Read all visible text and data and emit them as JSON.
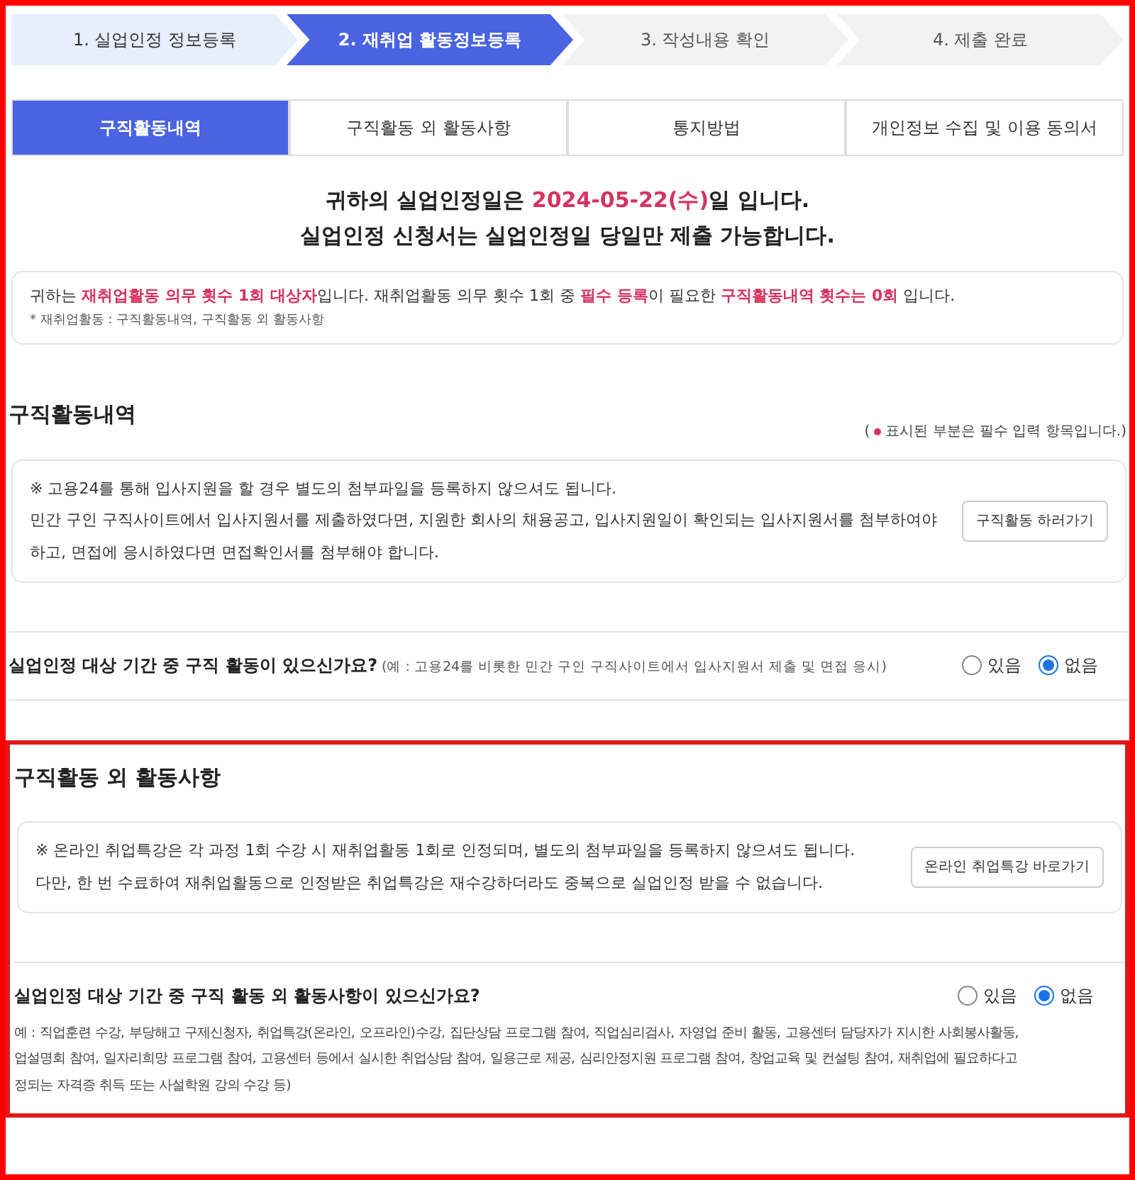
{
  "steps": [
    {
      "label": "1. 실업인정 정보등록",
      "selected": false,
      "completed": true
    },
    {
      "label": "2. 재취업 활동정보등록",
      "selected": true,
      "completed": false
    },
    {
      "label": "3. 작성내용 확인",
      "selected": false,
      "completed": false
    },
    {
      "label": "4. 제출 완료",
      "selected": false,
      "completed": false
    }
  ],
  "tabs": [
    {
      "label": "구직활동내역",
      "selected": true
    },
    {
      "label": "구직활동 외 활동사항",
      "selected": false
    },
    {
      "label": "통지방법",
      "selected": false
    },
    {
      "label": "개인정보 수집 및 이용 동의서",
      "selected": false
    }
  ],
  "headline": [
    [
      {
        "text": "귀하의 실업인정일은 ",
        "highlight": false
      },
      {
        "text": "2024-05-22(수)",
        "highlight": true
      },
      {
        "text": "일 입니다.",
        "highlight": false
      }
    ],
    [
      {
        "text": "실업인정 신청서는 실업인정일 당일만 제출 가능합니다.",
        "highlight": false
      }
    ]
  ],
  "notice": {
    "sentence": [
      {
        "text": "귀하는 ",
        "highlight": false
      },
      {
        "text": "재취업활동 의무 횟수 1회 대상자",
        "highlight": true
      },
      {
        "text": "입니다. 재취업활동 의무 횟수 1회 중 ",
        "highlight": false
      },
      {
        "text": "필수 등록",
        "highlight": true
      },
      {
        "text": "이 필요한 ",
        "highlight": false
      },
      {
        "text": "구직활동내역 횟수는 0회",
        "highlight": true
      },
      {
        "text": " 입니다.",
        "highlight": false
      }
    ],
    "footnote": "* 재취업활동 : 구직활동내역, 구직활동 외 활동사항"
  },
  "sections": [
    {
      "title": "구직활동내역",
      "required_note": {
        "open": "(",
        "text": "표시된 부분은 필수 입력 항목입니다.)"
      },
      "highlighted": false,
      "info_lines": [
        "※ 고용24를 통해 입사지원을 할 경우 별도의 첨부파일을 등록하지 않으셔도 됩니다.",
        "민간 구인 구직사이트에서 입사지원서를 제출하였다면, 지원한 회사의 채용공고, 입사지원일이 확인되는 입사지원서를 첨부하여야",
        "하고, 면접에 응시하였다면 면접확인서를 첨부해야 합니다."
      ],
      "button": "구직활동 하러가기",
      "question": "실업인정 대상 기간 중 구직 활동이 있으신가요?",
      "question_hint": "(예 : 고용24를 비롯한 민간 구인 구직사이트에서 입사지원서 제출 및 면접 응시)",
      "options": [
        {
          "label": "있음",
          "selected": false
        },
        {
          "label": "없음",
          "selected": true
        }
      ]
    },
    {
      "title": "구직활동 외 활동사항",
      "highlighted": true,
      "info_lines": [
        "※ 온라인 취업특강은 각 과정 1회 수강 시 재취업활동 1회로 인정되며, 별도의 첨부파일을 등록하지 않으셔도 됩니다.",
        "다만, 한 번 수료하여 재취업활동으로 인정받은 취업특강은 재수강하더라도 중복으로 실업인정 받을 수 없습니다."
      ],
      "button": "온라인 취업특강 바로가기",
      "question": "실업인정 대상 기간 중 구직 활동 외 활동사항이 있으신가요?",
      "options": [
        {
          "label": "있음",
          "selected": false
        },
        {
          "label": "없음",
          "selected": true
        }
      ],
      "example_lines": [
        "예 : 직업훈련 수강, 부당해고 구제신청자, 취업특강(온라인, 오프라인)수강, 집단상담 프로그램 참여, 직업심리검사, 자영업 준비 활동, 고용센터 담당자가 지시한 사회봉사활동,",
        "업설명회 참여, 일자리희망 프로그램 참여, 고용센터 등에서 실시한 취업상담 참여, 일용근로 제공, 심리안정지원 프로그램 참여, 창업교육 및 컨설팅 참여, 재취업에 필요하다고",
        "정되는 자격증 취득 또는 사설학원 강의 수강 등)"
      ]
    }
  ]
}
